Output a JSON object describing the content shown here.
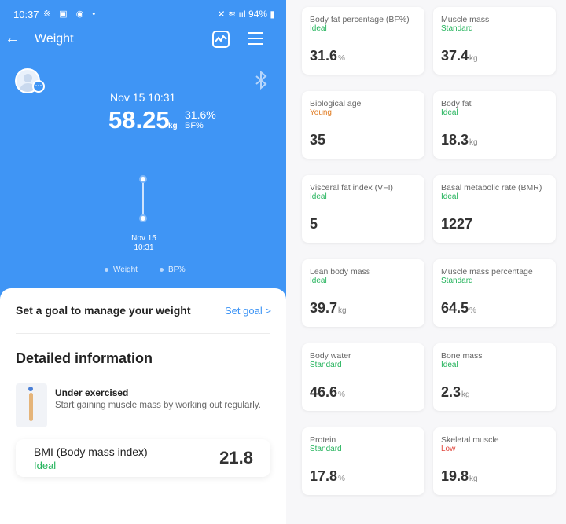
{
  "status": {
    "time": "10:37",
    "battery": "94%",
    "left_icons": "※ ▣ ◉ •",
    "right_icons": "✕ ≋ ııl"
  },
  "appbar": {
    "title": "Weight",
    "back_icon": "arrow-left-icon",
    "chart_icon": "chart-icon",
    "menu_icon": "menu-icon"
  },
  "summary": {
    "datetime": "Nov 15 10:31",
    "weight": "58.25",
    "weight_unit": "kg",
    "bf": "31.6%",
    "bf_label": "BF%"
  },
  "chart": {
    "x_date": "Nov 15",
    "x_time": "10:31",
    "legend_weight": "Weight",
    "legend_bf": "BF%"
  },
  "goal": {
    "text": "Set a goal to manage your weight",
    "link": "Set goal >"
  },
  "details": {
    "title": "Detailed information",
    "exercise_title": "Under exercised",
    "exercise_desc": "Start gaining muscle mass by working out regularly.",
    "bmi_label": "BMI  (Body mass index)",
    "bmi_status": "Ideal",
    "bmi_value": "21.8"
  },
  "metrics": [
    {
      "title": "Body fat percentage (BF%)",
      "status": "Ideal",
      "value": "31.6",
      "unit": "%"
    },
    {
      "title": "Muscle mass",
      "status": "Standard",
      "value": "37.4",
      "unit": "kg"
    },
    {
      "title": "Biological age",
      "status": "Young",
      "value": "35",
      "unit": ""
    },
    {
      "title": "Body fat",
      "status": "Ideal",
      "value": "18.3",
      "unit": "kg"
    },
    {
      "title": "Visceral fat index (VFI)",
      "status": "Ideal",
      "value": "5",
      "unit": ""
    },
    {
      "title": "Basal metabolic rate (BMR)",
      "status": "Ideal",
      "value": "1227",
      "unit": ""
    },
    {
      "title": "Lean body mass",
      "status": "Ideal",
      "value": "39.7",
      "unit": "kg"
    },
    {
      "title": "Muscle mass percentage",
      "status": "Standard",
      "value": "64.5",
      "unit": "%"
    },
    {
      "title": "Body water",
      "status": "Standard",
      "value": "46.6",
      "unit": "%"
    },
    {
      "title": "Bone mass",
      "status": "Ideal",
      "value": "2.3",
      "unit": "kg"
    },
    {
      "title": "Protein",
      "status": "Standard",
      "value": "17.8",
      "unit": "%"
    },
    {
      "title": "Skeletal muscle",
      "status": "Low",
      "value": "19.8",
      "unit": "kg"
    }
  ],
  "colors": {
    "primary": "#3f95f5",
    "ideal": "#23b35b",
    "young": "#e07a1f",
    "low": "#e0463c"
  }
}
